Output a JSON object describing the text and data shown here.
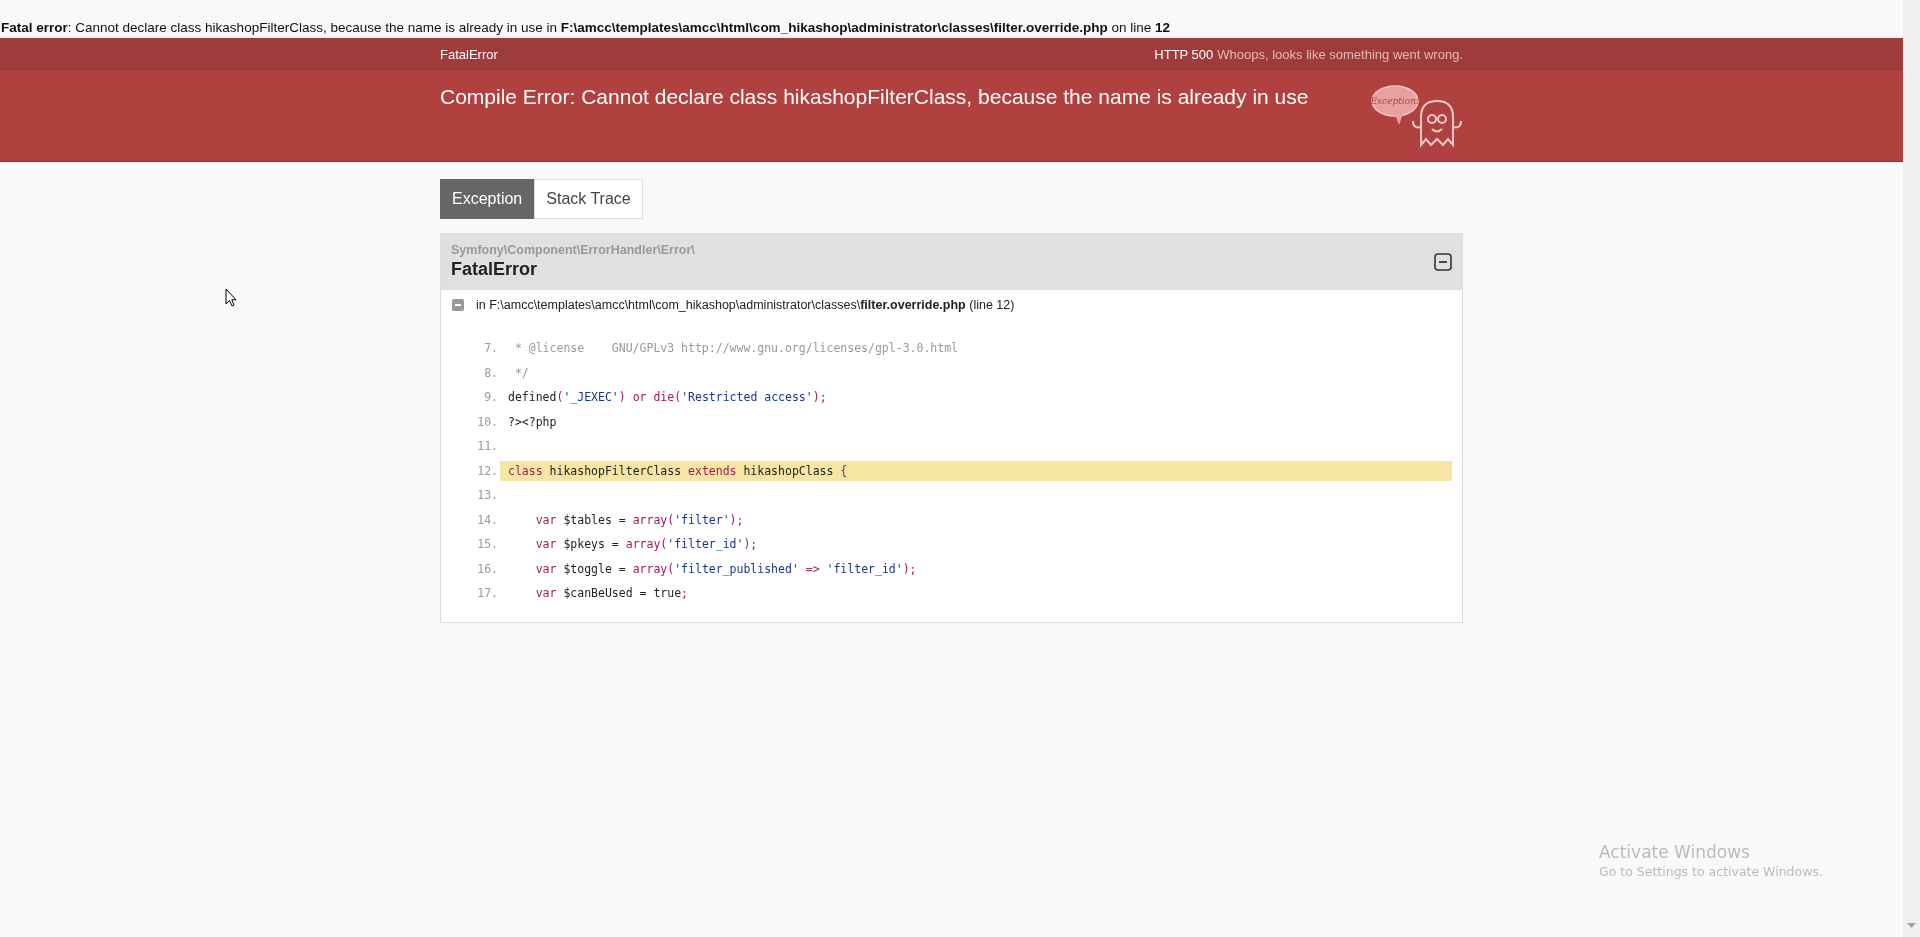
{
  "php_error": "**Fatal error**: Cannot declare class hikashopFilterClass, because the name is already in use in **F:\\amcc\\templates\\amcc\\html\\com_hikashop\\administrator\\classes\\filter.override.php** on line **12**",
  "header": {
    "exception_class": "FatalError",
    "status": "HTTP 500",
    "status_message": "Whoops, looks like something went wrong.",
    "title": "Compile Error: Cannot declare class hikashopFilterClass, because the name is already in use",
    "mascot_bubble": "Exception!"
  },
  "tabs": [
    {
      "label": "Exception",
      "selected": true
    },
    {
      "label": "Stack Trace",
      "selected": false
    }
  ],
  "exception": {
    "namespace": "Symfony\\Component\\ErrorHandler\\Error\\",
    "class": "FatalError",
    "expanded": true,
    "file_line": "in F:\\amcc\\templates\\amcc\\html\\com_hikashop\\administrator\\classes\\**filter.override.php** (line 12)",
    "code_lines": [
      {
        "number": "7.",
        "highlighted": false,
        "tokens": [
          {
            "text": " * @license    GNU/GPLv3 http://www.gnu.org/licenses/gpl-3.0.html",
            "kind": "comment"
          }
        ]
      },
      {
        "number": "8.",
        "highlighted": false,
        "tokens": [
          {
            "text": " */",
            "kind": "comment"
          }
        ]
      },
      {
        "number": "9.",
        "highlighted": false,
        "tokens": [
          {
            "text": "defined",
            "kind": "plain"
          },
          {
            "text": "(",
            "kind": "punct"
          },
          {
            "text": "'_JEXEC'",
            "kind": "string"
          },
          {
            "text": ") ",
            "kind": "punct"
          },
          {
            "text": "or die",
            "kind": "keyword"
          },
          {
            "text": "(",
            "kind": "punct"
          },
          {
            "text": "'Restricted access'",
            "kind": "string"
          },
          {
            "text": ");",
            "kind": "punct"
          }
        ]
      },
      {
        "number": "10.",
        "highlighted": false,
        "tokens": [
          {
            "text": "?><?php",
            "kind": "plain"
          }
        ]
      },
      {
        "number": "11.",
        "highlighted": false
      },
      {
        "number": "12.",
        "highlighted": true,
        "tokens": [
          {
            "text": "class",
            "kind": "keyword"
          },
          {
            "text": " hikashopFilterClass ",
            "kind": "plain"
          },
          {
            "text": "extends",
            "kind": "keyword"
          },
          {
            "text": " hikashopClass ",
            "kind": "plain"
          },
          {
            "text": "{",
            "kind": "punct"
          }
        ]
      },
      {
        "number": "13.",
        "highlighted": false
      },
      {
        "number": "14.",
        "highlighted": false,
        "tokens": [
          {
            "text": "    var",
            "kind": "keyword"
          },
          {
            "text": " $tables = ",
            "kind": "plain"
          },
          {
            "text": "array(",
            "kind": "keyword"
          },
          {
            "text": "'filter'",
            "kind": "string"
          },
          {
            "text": ");",
            "kind": "punct"
          }
        ]
      },
      {
        "number": "15.",
        "highlighted": false,
        "tokens": [
          {
            "text": "    var",
            "kind": "keyword"
          },
          {
            "text": " $pkeys = ",
            "kind": "plain"
          },
          {
            "text": "array(",
            "kind": "keyword"
          },
          {
            "text": "'filter_id'",
            "kind": "string"
          },
          {
            "text": ");",
            "kind": "punct"
          }
        ]
      },
      {
        "number": "16.",
        "highlighted": false,
        "tokens": [
          {
            "text": "    var",
            "kind": "keyword"
          },
          {
            "text": " $toggle = ",
            "kind": "plain"
          },
          {
            "text": "array(",
            "kind": "keyword"
          },
          {
            "text": "'filter_published'",
            "kind": "string"
          },
          {
            "text": " => ",
            "kind": "punct"
          },
          {
            "text": "'filter_id'",
            "kind": "string"
          },
          {
            "text": ");",
            "kind": "punct"
          }
        ]
      },
      {
        "number": "17.",
        "highlighted": false,
        "tokens": [
          {
            "text": "    var",
            "kind": "keyword"
          },
          {
            "text": " $canBeUsed = true",
            "kind": "plain"
          },
          {
            "text": ";",
            "kind": "punct"
          }
        ]
      }
    ]
  },
  "os_notice": {
    "title": "Activate Windows",
    "message": "Go to Settings to activate Windows."
  }
}
